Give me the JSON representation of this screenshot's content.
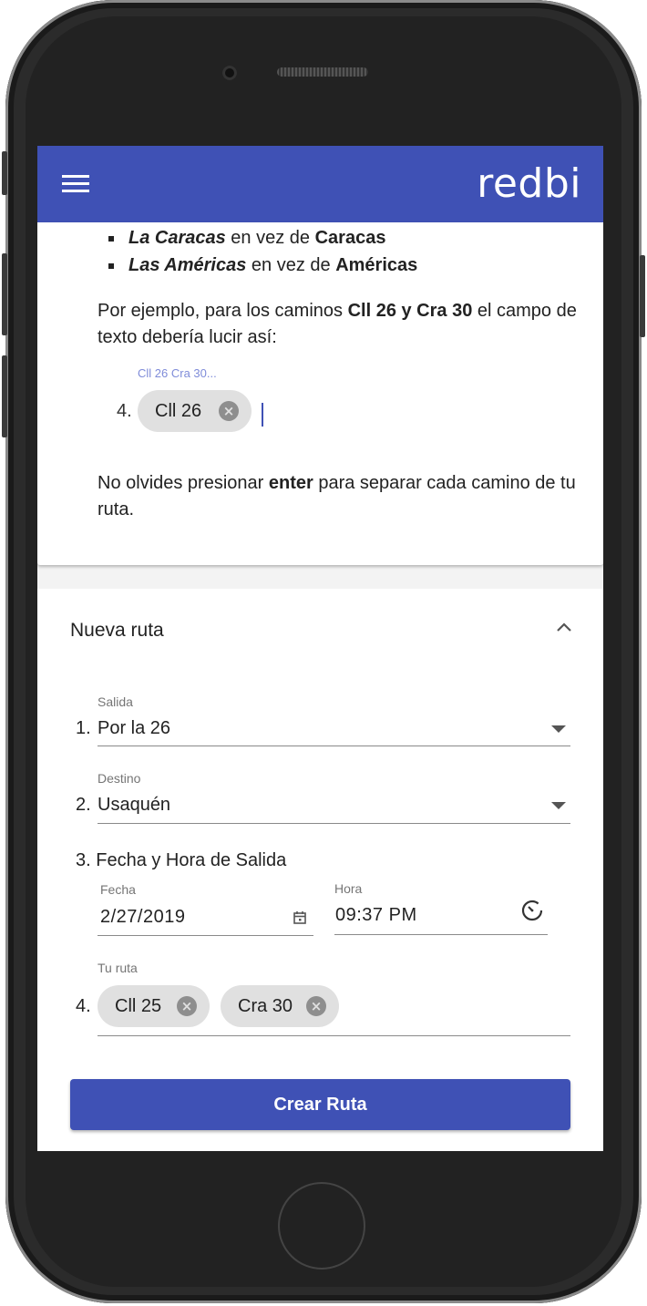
{
  "app": {
    "logo_text": "redbi",
    "accent_color": "#3f51b5"
  },
  "instructions": {
    "bullets": [
      {
        "bold": "La Caracas",
        "mid": " en vez de ",
        "bold2": "Caracas"
      },
      {
        "bold": "Las Américas",
        "mid": " en vez de ",
        "bold2": "Américas"
      }
    ],
    "example_para": {
      "a": "Por ejemplo, para los caminos ",
      "b": "Cll 26 y Cra 30",
      "c": " el campo de texto debería lucir así:"
    },
    "example_label": "Cll 26 Cra 30...",
    "example_num": "4.",
    "example_chip": "Cll 26",
    "enter_para": {
      "a": "No olvides presionar ",
      "b": "enter",
      "c": " para separar cada camino de tu ruta."
    }
  },
  "form": {
    "title": "Nueva ruta",
    "salida": {
      "num": "1.",
      "label": "Salida",
      "value": "Por la 26"
    },
    "destino": {
      "num": "2.",
      "label": "Destino",
      "value": "Usaquén"
    },
    "fecha_hora": {
      "heading": "3. Fecha y Hora de Salida",
      "fecha_label": "Fecha",
      "fecha_value": "2/27/2019",
      "hora_label": "Hora",
      "hora_value": "09:37 PM"
    },
    "ruta": {
      "num": "4.",
      "label": "Tu ruta",
      "chips": [
        "Cll 25",
        "Cra 30"
      ]
    },
    "submit_label": "Crear Ruta"
  },
  "icons": [
    "menu-icon",
    "chevron-up-icon",
    "dropdown-arrow-icon",
    "calendar-icon",
    "clock-icon",
    "chip-remove-icon"
  ]
}
